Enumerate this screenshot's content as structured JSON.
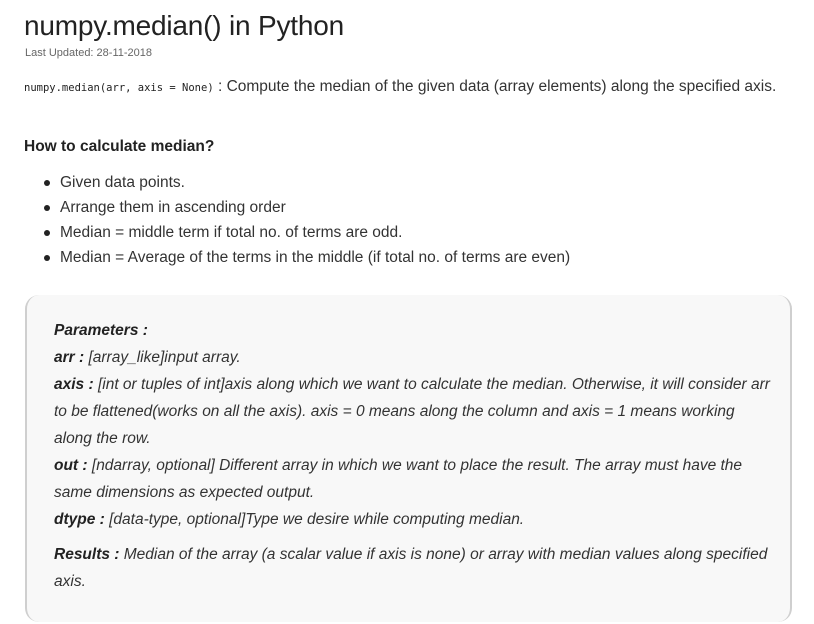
{
  "article": {
    "title": "numpy.median() in Python",
    "last_updated": "Last Updated: 28-11-2018",
    "signature": "numpy.median(arr, axis = None)",
    "signature_sep": " : ",
    "description": "Compute the median of the given data (array elements) along the specified axis.",
    "heading": "How to calculate median?",
    "steps": [
      "Given data points.",
      "Arrange them in ascending order",
      "Median = middle term if total no. of terms are odd.",
      "Median = Average of the terms in the middle (if total no. of terms are even)"
    ]
  },
  "parameters": {
    "heading": "Parameters :",
    "items": [
      {
        "name": "arr :",
        "desc": " [array_like]input array."
      },
      {
        "name": "axis :",
        "desc": " [int or tuples of int]axis along which we want to calculate the median. Otherwise, it will consider arr to be flattened(works on all the axis). axis = 0 means along the column and axis = 1 means working along the row."
      },
      {
        "name": "out :",
        "desc": " [ndarray, optional] Different array in which we want to place the result. The array must have the same dimensions as expected output."
      },
      {
        "name": "dtype :",
        "desc": " [data-type, optional]Type we desire while computing median."
      }
    ],
    "results_label": "Results :",
    "results_desc": " Median of the array (a scalar value if axis is none) or array with median values along specified axis."
  }
}
